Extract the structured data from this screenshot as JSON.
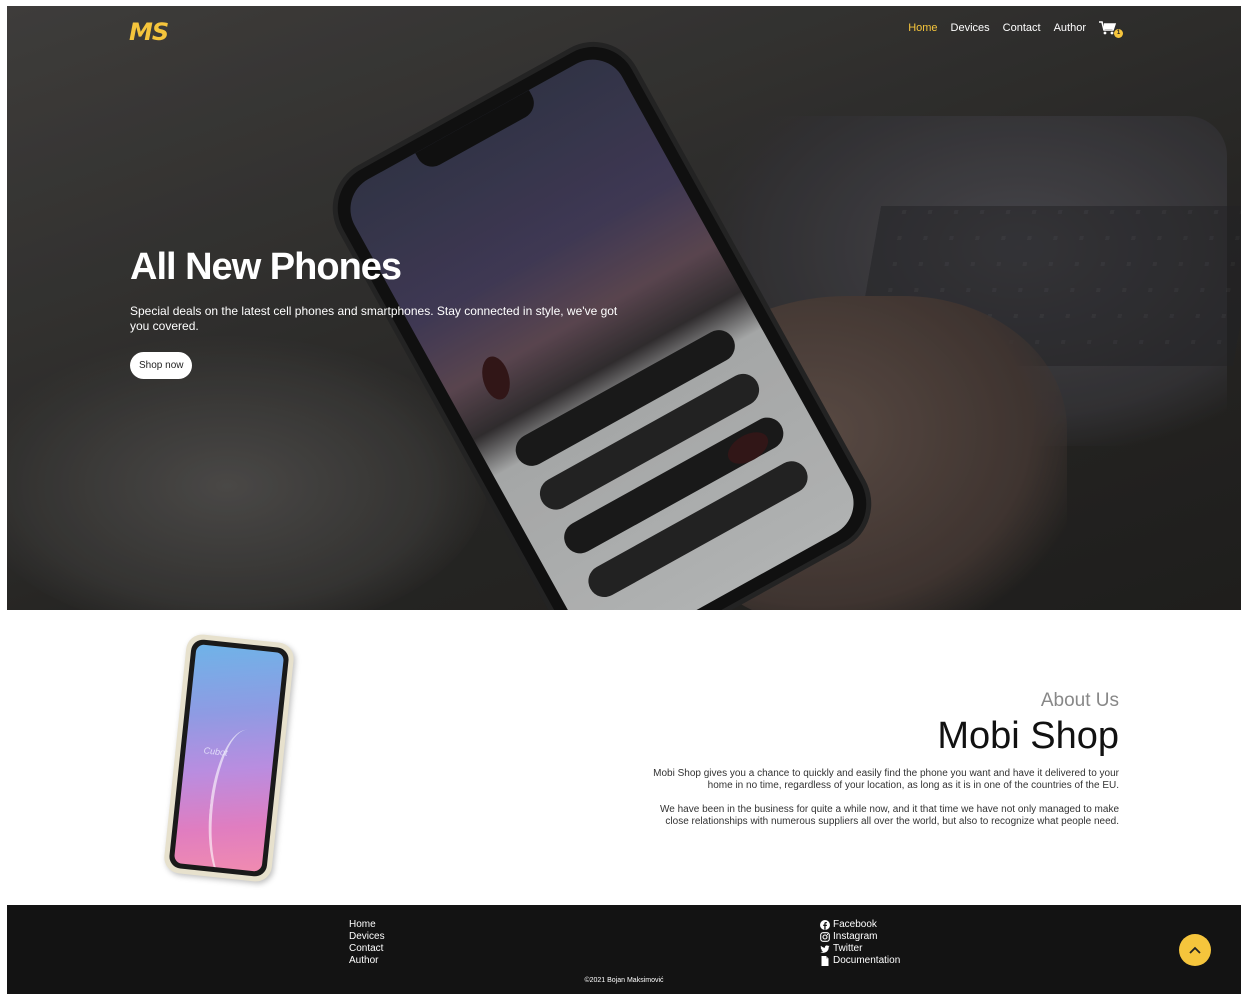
{
  "brand": {
    "logo": "MS"
  },
  "nav": {
    "items": [
      {
        "label": "Home",
        "active": true
      },
      {
        "label": "Devices",
        "active": false
      },
      {
        "label": "Contact",
        "active": false
      },
      {
        "label": "Author",
        "active": false
      }
    ],
    "cart_count": "1"
  },
  "hero": {
    "title": "All New Phones",
    "text": "Special deals on the latest cell phones and smartphones. Stay connected in style, we've got you covered.",
    "button": "Shop now"
  },
  "about": {
    "subtitle": "About Us",
    "title": "Mobi Shop",
    "p1": "Mobi Shop gives you a chance to quickly and easily find the phone you want and have it delivered to your home in no time, regardless of your location, as long as it is in one of the countries of the EU.",
    "p2": "We have been in the business for quite a while now, and it that time we have not only managed to make close relationships with numerous suppliers all over the world, but also to recognize what people need."
  },
  "footer": {
    "links": [
      "Home",
      "Devices",
      "Contact",
      "Author"
    ],
    "social": [
      {
        "label": "Facebook",
        "icon": "facebook-icon"
      },
      {
        "label": "Instagram",
        "icon": "instagram-icon"
      },
      {
        "label": "Twitter",
        "icon": "twitter-icon"
      },
      {
        "label": "Documentation",
        "icon": "document-icon"
      }
    ],
    "copyright": "©2021 Bojan Maksimović"
  },
  "colors": {
    "accent": "#f5c53c",
    "footer_bg": "#131313"
  }
}
